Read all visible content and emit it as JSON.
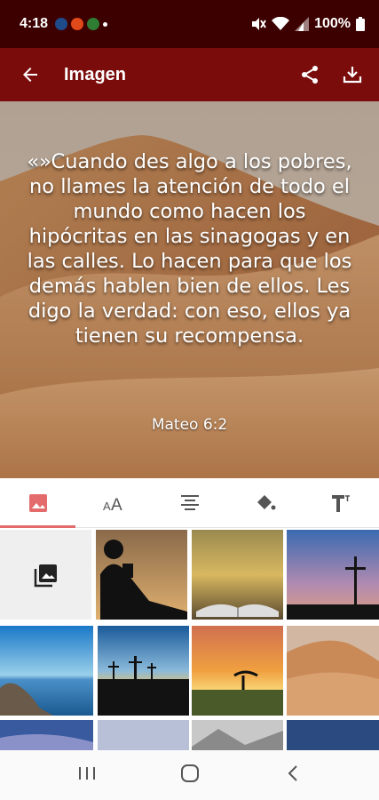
{
  "status_bar": {
    "time": "4:18",
    "battery": "100%"
  },
  "app_bar": {
    "title": "Imagen"
  },
  "preview": {
    "quote": "«»Cuando des algo a los pobres, no llames la atención de todo el mundo como hacen los hipócritas en las sinagogas y en las calles. Lo hacen para que los demás hablen bien de ellos. Les digo la verdad: con eso, ellos ya tienen su recompensa.",
    "reference": "Mateo 6:2"
  },
  "tabs": [
    {
      "name": "background-tab",
      "icon": "image-icon",
      "active": true
    },
    {
      "name": "font-tab",
      "icon": "font-size-icon",
      "active": false
    },
    {
      "name": "align-tab",
      "icon": "align-center-icon",
      "active": false
    },
    {
      "name": "color-tab",
      "icon": "paint-bucket-icon",
      "active": false
    },
    {
      "name": "text-style-tab",
      "icon": "text-format-icon",
      "active": false
    }
  ],
  "colors": {
    "status_bar": "#3d0000",
    "app_bar": "#7a0c0c",
    "tab_indicator": "#e36b6b"
  }
}
